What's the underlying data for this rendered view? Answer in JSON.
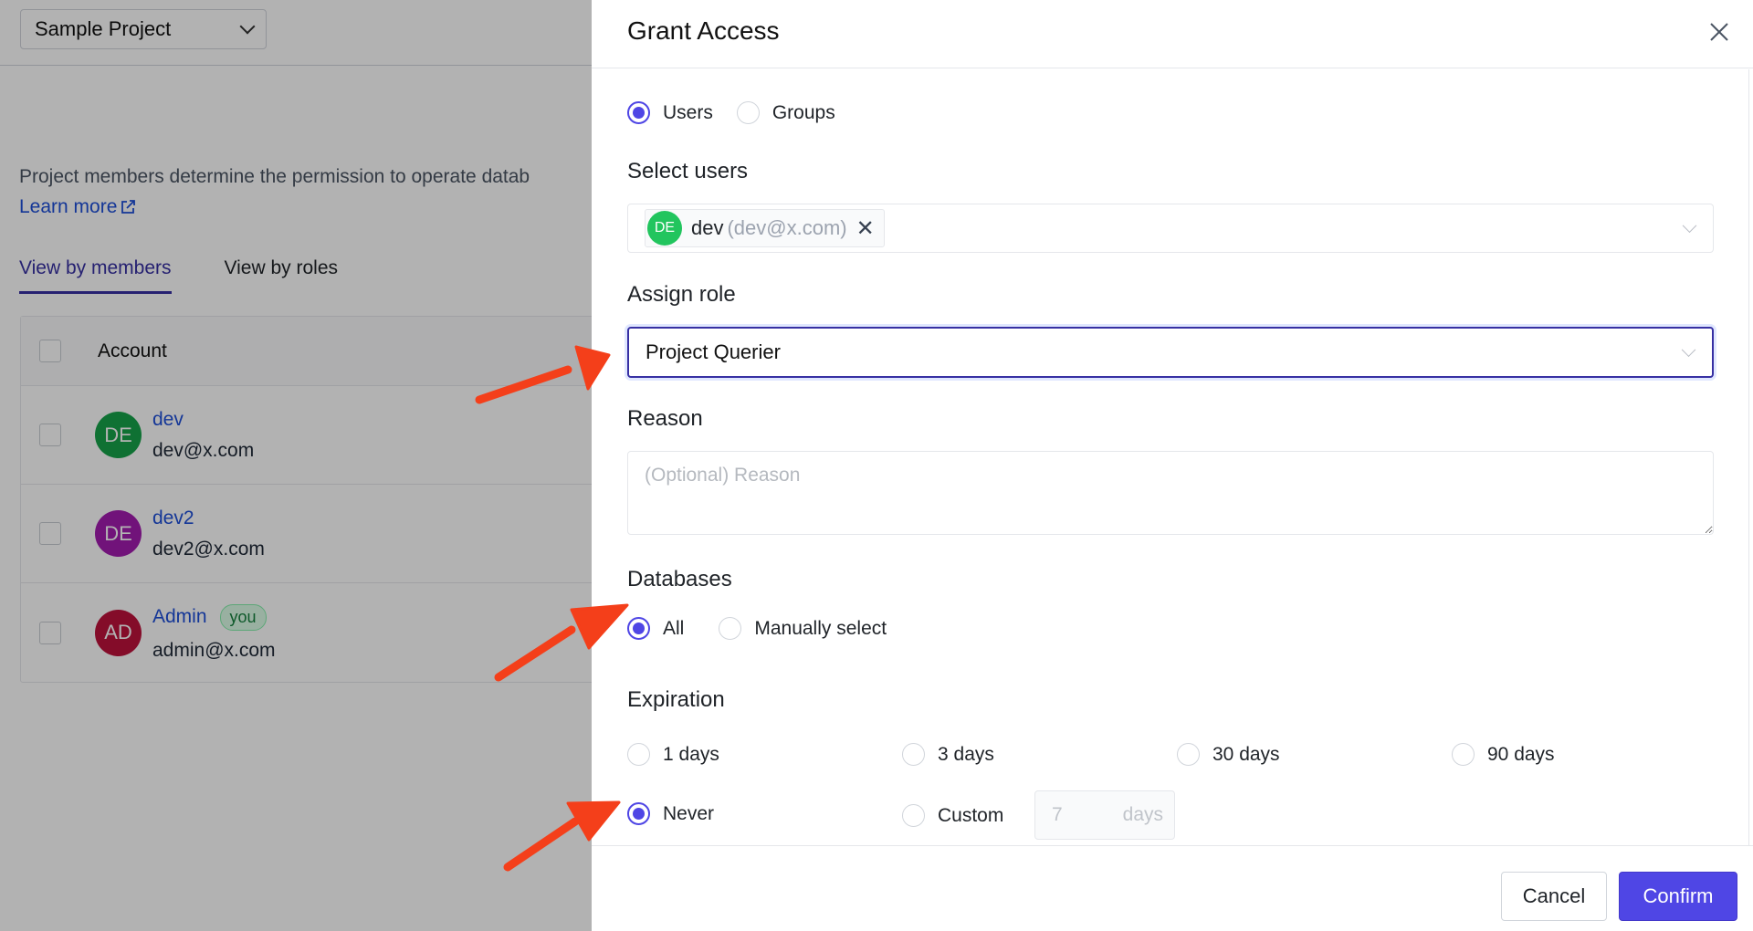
{
  "background": {
    "project_selector": {
      "value": "Sample Project",
      "icon": "chevron-down-icon"
    },
    "description": "Project members determine the permission to operate datab",
    "learn_more": {
      "label": "Learn more",
      "icon": "external-link-icon"
    },
    "tabs": [
      {
        "label": "View by members",
        "active": true
      },
      {
        "label": "View by roles",
        "active": false
      }
    ],
    "table": {
      "header": "Account",
      "rows": [
        {
          "initials": "DE",
          "name": "dev",
          "email": "dev@x.com",
          "color": "#16a34a",
          "badge": ""
        },
        {
          "initials": "DE",
          "name": "dev2",
          "email": "dev2@x.com",
          "color": "#a21caf",
          "badge": ""
        },
        {
          "initials": "AD",
          "name": "Admin",
          "email": "admin@x.com",
          "color": "#be123c",
          "badge": "you"
        }
      ]
    }
  },
  "drawer": {
    "title": "Grant Access",
    "close_icon": "close-icon",
    "target_type": {
      "options": [
        "Users",
        "Groups"
      ],
      "selected": "Users"
    },
    "select_users": {
      "label": "Select users",
      "selected": [
        {
          "initials": "DE",
          "name": "dev",
          "email": "(dev@x.com)",
          "color": "#22c55e"
        }
      ]
    },
    "assign_role": {
      "label": "Assign role",
      "value": "Project Querier"
    },
    "reason": {
      "label": "Reason",
      "placeholder": "(Optional) Reason",
      "value": ""
    },
    "databases": {
      "label": "Databases",
      "options": [
        "All",
        "Manually select"
      ],
      "selected": "All"
    },
    "expiration": {
      "label": "Expiration",
      "options": [
        "1 days",
        "3 days",
        "30 days",
        "90 days",
        "Never",
        "Custom"
      ],
      "selected": "Never",
      "custom_value": "7",
      "custom_unit": "days"
    },
    "footer": {
      "cancel": "Cancel",
      "confirm": "Confirm"
    }
  },
  "colors": {
    "accent": "#4f46e5",
    "annotation_arrow": "#f43f1a"
  }
}
